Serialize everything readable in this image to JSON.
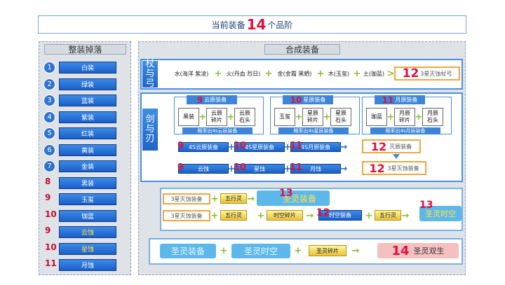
{
  "title": {
    "before": "当前装备",
    "num": "14",
    "after": "个品阶"
  },
  "left_panel": {
    "header": "整装掉落",
    "items": [
      {
        "n": "1",
        "label": "白装",
        "style": "circle"
      },
      {
        "n": "2",
        "label": "绿装",
        "style": "circle"
      },
      {
        "n": "3",
        "label": "蓝装",
        "style": "circle"
      },
      {
        "n": "4",
        "label": "紫装",
        "style": "circle"
      },
      {
        "n": "5",
        "label": "红装",
        "style": "circle"
      },
      {
        "n": "6",
        "label": "黄装",
        "style": "circle"
      },
      {
        "n": "7",
        "label": "金装",
        "style": "circle"
      },
      {
        "n": "8",
        "label": "黑装",
        "style": "red"
      },
      {
        "n": "9",
        "label": "玉玺",
        "style": "red"
      },
      {
        "n": "10",
        "label": "珈蓝",
        "style": "red"
      },
      {
        "n": "9",
        "label": "云蚀",
        "style": "red_yellow"
      },
      {
        "n": "10",
        "label": "星蚀",
        "style": "red_yellow"
      },
      {
        "n": "11",
        "label": "月蚀",
        "style": "red"
      }
    ]
  },
  "right_panel": {
    "header": "合成装备",
    "staff_bow": {
      "tab": [
        "杖",
        "与",
        "弓"
      ],
      "chain": [
        "水(海洋 紫凌)",
        "火(丹血 烈日)",
        "金(金霜 黑晒)",
        "木(玉玺)",
        "土(珈蓝)"
      ],
      "result_num": "12",
      "result_label": "3星灭蚀杖弓"
    },
    "sword_blade": {
      "tab": [
        "剑",
        "与",
        "刃"
      ],
      "groups": [
        {
          "num": "9",
          "title": "云辰装备",
          "items": [
            "黑装",
            "云辰\n碎片",
            "云辰\n石头"
          ],
          "footer": "概率出4s云辰装备"
        },
        {
          "num": "10",
          "title": "星辰装备",
          "items": [
            "玉玺",
            "星辰\n碎片",
            "星辰\n石头"
          ],
          "footer": "概率出4s星辰装备"
        },
        {
          "num": "11",
          "title": "月辰装备",
          "items": [
            "珈蓝",
            "月辰\n碎片",
            "月辰\n石头"
          ],
          "footer": "概率出4s月辰装备"
        }
      ],
      "row1": [
        {
          "num": "9",
          "label": "4S云辰装备"
        },
        {
          "num": "10",
          "label": "4S星辰装备"
        },
        {
          "num": "11",
          "label": "4S月辰装备"
        }
      ],
      "row1_result": {
        "num": "12",
        "label": "灭辰装备"
      },
      "row2": [
        {
          "num": "9",
          "label": "云蚀"
        },
        {
          "num": "10",
          "label": "星蚀"
        },
        {
          "num": "11",
          "label": "月蚀"
        }
      ],
      "row2_result": {
        "num": "12",
        "label": "3星灭蚀装备"
      }
    },
    "spirit": {
      "r1": {
        "a": "3星灭蚀装备",
        "b": "五行灵",
        "num": "13",
        "result": "圣灵装备"
      },
      "r2": {
        "a": "3星灭蚀装备",
        "b": "五行灵",
        "c": "时空碎片",
        "num": "12",
        "d": "时空装备",
        "e": "五行灵",
        "num2": "13",
        "result": "圣灵时空"
      }
    },
    "final": {
      "a": "圣灵装备",
      "b": "圣灵时空",
      "c": "圣灵碎片",
      "num": "14",
      "result": "圣灵双生"
    }
  },
  "colors": {
    "accent": "#2e73cf",
    "red": "#e0103a",
    "green_plus": "#8ac02a"
  }
}
